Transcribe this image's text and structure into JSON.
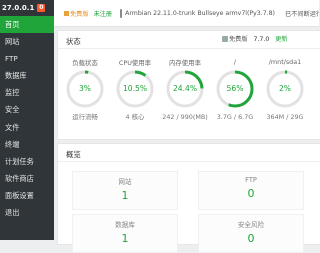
{
  "sidebar": {
    "ip": "27.0.0.1",
    "badge": "0",
    "items": [
      "首页",
      "网站",
      "FTP",
      "数据库",
      "监控",
      "安全",
      "文件",
      "终端",
      "计划任务",
      "软件商店",
      "面板设置",
      "退出"
    ],
    "active_index": 0
  },
  "topbar": {
    "free_label": "免费版",
    "register_label": "未注册",
    "system_text": "Armbian 22.11.0-trunk Bullseye armv7l(Py3.7.8)",
    "uptime_text": "已不间断运行"
  },
  "status": {
    "title": "状态",
    "version_label": "免费版",
    "version": "7.7.0",
    "update_label": "更新",
    "gauges": [
      {
        "label": "负载状态",
        "value": "3%",
        "percent": 3,
        "sub": "运行流畅"
      },
      {
        "label": "CPU使用率",
        "value": "10.5%",
        "percent": 10.5,
        "sub": "4 核心"
      },
      {
        "label": "内存使用率",
        "value": "24.4%",
        "percent": 24.4,
        "sub": "242 / 990(MB)"
      },
      {
        "label": "/",
        "value": "56%",
        "percent": 56,
        "sub": "3.7G / 6.7G"
      },
      {
        "label": "/mnt/sda1",
        "value": "2%",
        "percent": 2,
        "sub": "364M / 29G"
      }
    ]
  },
  "overview": {
    "title": "概览",
    "items": [
      {
        "label": "网站",
        "value": "1"
      },
      {
        "label": "FTP",
        "value": "0"
      },
      {
        "label": "数据库",
        "value": "1"
      },
      {
        "label": "安全风险",
        "value": "0"
      }
    ]
  },
  "colors": {
    "accent": "#20a53a",
    "sidebar_bg": "#2f3538",
    "badge": "#fb5a2a"
  }
}
